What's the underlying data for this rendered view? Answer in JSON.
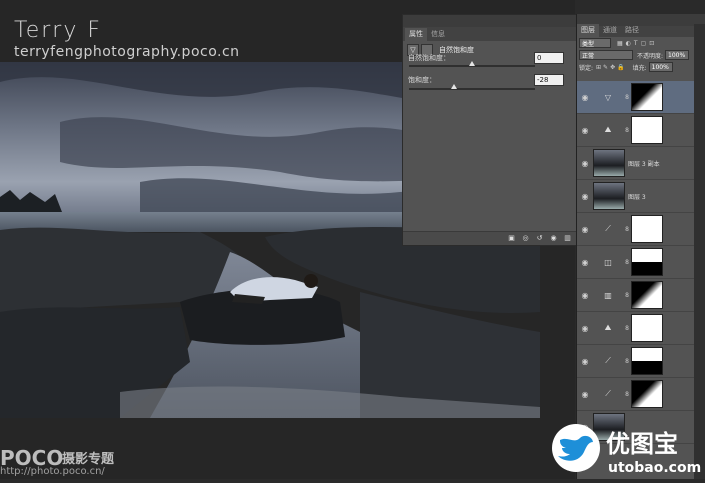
{
  "watermark": {
    "title": "Terry F",
    "url": "terryfengphotography.poco.cn"
  },
  "footer": {
    "poco": "POCO",
    "poco_sub": "摄影专题",
    "poco_url": "http://photo.poco.cn/"
  },
  "properties_panel": {
    "tabs": [
      "属性",
      "信息"
    ],
    "adjustment_title": "自然饱和度",
    "vibrance": {
      "label": "自然饱和度：",
      "value": "0",
      "level": 0
    },
    "saturation": {
      "label": "饱和度：",
      "value": "-28",
      "level": -28
    }
  },
  "layers_panel": {
    "tabs": [
      "图层",
      "通道",
      "路径"
    ],
    "filter_kind": "类型",
    "blend_mode": "正常",
    "opacity_label": "不透明度:",
    "opacity_value": "100%",
    "lock_label": "锁定:",
    "fill_label": "填充:",
    "fill_value": "100%",
    "layers": [
      {
        "type": "adjustment",
        "icon": "vibrance-icon",
        "name": "",
        "selected": true
      },
      {
        "type": "adjustment",
        "icon": "levels-icon",
        "name": "",
        "selected": false
      },
      {
        "type": "image",
        "icon": "photo-thumb",
        "name": "图层 3 副本",
        "selected": false
      },
      {
        "type": "image",
        "icon": "photo-thumb",
        "name": "图层 3",
        "selected": false
      },
      {
        "type": "adjustment",
        "icon": "curves-icon",
        "name": "",
        "selected": false
      },
      {
        "type": "adjustment",
        "icon": "exposure-icon",
        "name": "",
        "selected": false
      },
      {
        "type": "adjustment",
        "icon": "channel-mixer-icon",
        "name": "",
        "selected": false
      },
      {
        "type": "adjustment",
        "icon": "levels-icon",
        "name": "",
        "selected": false
      },
      {
        "type": "adjustment",
        "icon": "curves-icon",
        "name": "",
        "selected": false
      },
      {
        "type": "adjustment",
        "icon": "curves-icon",
        "name": "",
        "selected": false
      },
      {
        "type": "image",
        "icon": "photo-thumb",
        "name": "",
        "selected": false
      }
    ]
  },
  "logo": {
    "text": "优图宝",
    "url": "utobao.com"
  },
  "colors": {
    "panel": "#535353",
    "selected_layer": "#5f6c80",
    "logo_blue": "#1e8fd8"
  }
}
